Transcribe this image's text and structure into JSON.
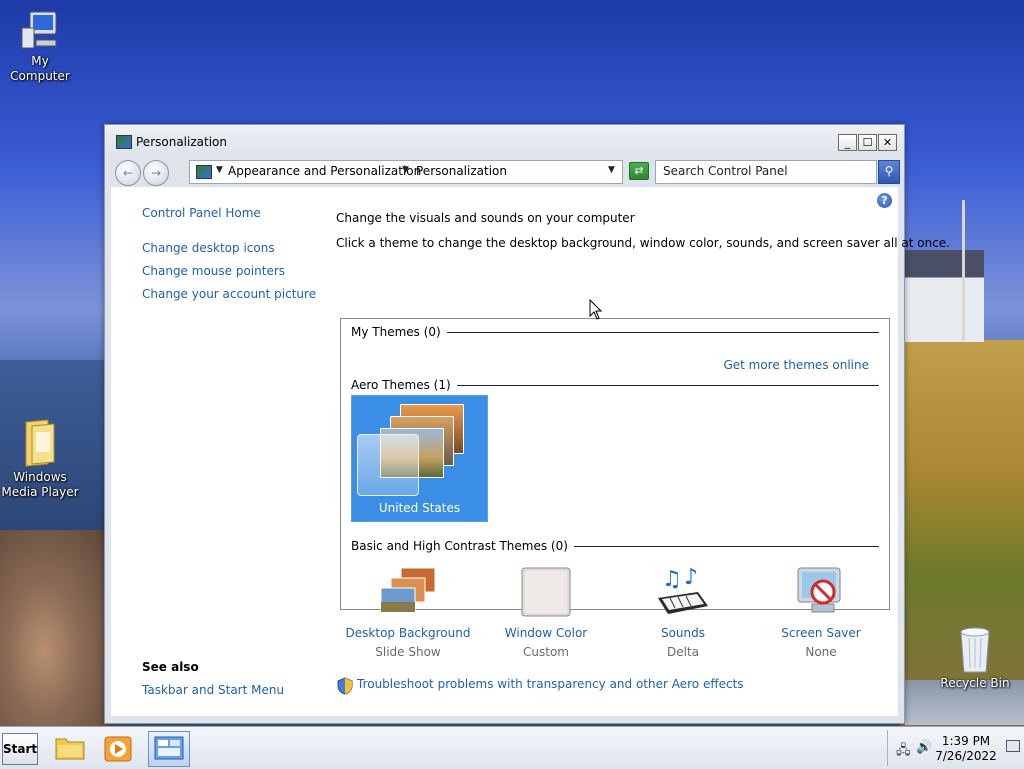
{
  "desktop": {
    "icons": [
      {
        "label": "My Computer"
      },
      {
        "label": "Windows Media Player"
      },
      {
        "label": "Recycle Bin"
      }
    ]
  },
  "window": {
    "title": "Personalization",
    "controls": {
      "minimize": "_",
      "maximize": "☐",
      "close": "✕"
    }
  },
  "navbar": {
    "breadcrumbs": [
      "Appearance and Personalization",
      "Personalization"
    ],
    "search_placeholder": "Search Control Panel"
  },
  "sidebar": {
    "home": "Control Panel Home",
    "links": [
      "Change desktop icons",
      "Change mouse pointers",
      "Change your account picture"
    ],
    "see_also_heading": "See also",
    "see_also_links": [
      "Taskbar and Start Menu"
    ]
  },
  "main": {
    "heading": "Change the visuals and sounds on your computer",
    "description": "Click a theme to change the desktop background, window color, sounds, and screen saver all at once.",
    "sections": {
      "my_themes": "My Themes (0)",
      "get_more": "Get more themes online",
      "aero_themes": "Aero Themes (1)",
      "basic_themes": "Basic and High Contrast Themes (0)"
    },
    "selected_theme": "United States",
    "settings": [
      {
        "label": "Desktop Background",
        "value": "Slide Show",
        "icon": "desktop-background-icon"
      },
      {
        "label": "Window Color",
        "value": "Custom",
        "icon": "window-color-icon"
      },
      {
        "label": "Sounds",
        "value": "Delta",
        "icon": "sounds-icon"
      },
      {
        "label": "Screen Saver",
        "value": "None",
        "icon": "screen-saver-icon"
      }
    ],
    "troubleshoot": "Troubleshoot problems with transparency and other Aero effects"
  },
  "taskbar": {
    "start_label": "Start",
    "time": "1:39 PM",
    "date": "7/26/2022"
  },
  "colors": {
    "link": "#1f5fb5",
    "tile_selected": "#3a8ee6"
  }
}
